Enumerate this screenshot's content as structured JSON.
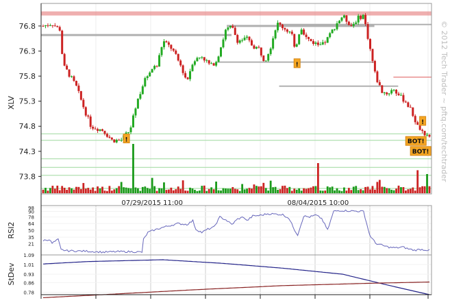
{
  "watermark": "© 2012 Tech Trader ~ pftq.com/techtrader",
  "chart_data": [
    {
      "type": "candlestick",
      "ylabel": "XLV",
      "ylim": [
        73.45,
        77.25
      ],
      "yticks": [
        73.8,
        74.3,
        74.8,
        75.3,
        75.8,
        76.3,
        76.8
      ],
      "x_labels": [
        {
          "label": "07/29/2015 11:00",
          "index": 46
        },
        {
          "label": "08/04/2015 10:00",
          "index": 116
        }
      ],
      "n_bars": 164,
      "anchors": [
        [
          0,
          76.8
        ],
        [
          6,
          76.85
        ],
        [
          10,
          76.75
        ],
        [
          12,
          76.72
        ],
        [
          13,
          76.02
        ],
        [
          16,
          75.9
        ],
        [
          22,
          75.6
        ],
        [
          28,
          75.1
        ],
        [
          32,
          74.8
        ],
        [
          40,
          74.72
        ],
        [
          46,
          74.52
        ],
        [
          52,
          74.52
        ],
        [
          58,
          74.72
        ],
        [
          62,
          75.2
        ],
        [
          66,
          75.6
        ],
        [
          72,
          75.95
        ],
        [
          76,
          76.0
        ],
        [
          80,
          76.5
        ],
        [
          86,
          76.35
        ],
        [
          92,
          76.0
        ],
        [
          96,
          75.7
        ],
        [
          100,
          76.1
        ],
        [
          106,
          76.2
        ],
        [
          112,
          76.0
        ],
        [
          116,
          76.12
        ],
        [
          122,
          76.72
        ],
        [
          126,
          76.78
        ],
        [
          130,
          76.5
        ],
        [
          136,
          76.55
        ],
        [
          140,
          76.4
        ],
        [
          144,
          76.35
        ],
        [
          148,
          76.1
        ],
        [
          152,
          76.4
        ],
        [
          156,
          76.85
        ],
        [
          160,
          76.78
        ],
        [
          166,
          76.65
        ],
        [
          168,
          76.3
        ],
        [
          172,
          76.8
        ],
        [
          176,
          76.55
        ],
        [
          180,
          76.48
        ],
        [
          186,
          76.4
        ],
        [
          190,
          76.55
        ],
        [
          196,
          76.85
        ],
        [
          200,
          77.0
        ],
        [
          206,
          76.8
        ],
        [
          210,
          76.95
        ],
        [
          214,
          77.02
        ],
        [
          218,
          76.4
        ],
        [
          222,
          75.8
        ],
        [
          226,
          75.5
        ],
        [
          230,
          75.45
        ],
        [
          234,
          75.55
        ],
        [
          238,
          75.4
        ],
        [
          242,
          75.3
        ],
        [
          246,
          75.1
        ],
        [
          250,
          74.8
        ],
        [
          252,
          74.7
        ],
        [
          258,
          74.62
        ]
      ],
      "up_color": "#22aa22",
      "down_color": "#cc2222",
      "volume": {
        "sample_bars": [
          {
            "i": 38,
            "v": 0.9
          },
          {
            "i": 46,
            "v": 0.28
          },
          {
            "i": 116,
            "v": 0.55
          },
          {
            "i": 158,
            "v": 0.42
          },
          {
            "i": 162,
            "v": 0.35
          }
        ]
      },
      "resistance_lines": [
        {
          "from": 0,
          "to": 164,
          "price": 77.05,
          "color": "#e06060",
          "width": 6,
          "opacity": 0.5
        },
        {
          "from": 0,
          "to": 80,
          "price": 76.62,
          "color": "#b0b0b0",
          "width": 3
        },
        {
          "from": 78,
          "to": 140,
          "price": 76.8,
          "color": "#b0b0b0",
          "width": 3
        },
        {
          "from": 100,
          "to": 164,
          "price": 76.83,
          "color": "#b0b0b0",
          "width": 2
        },
        {
          "from": 74,
          "to": 140,
          "price": 76.08,
          "color": "#b0b0b0",
          "width": 2
        },
        {
          "from": 100,
          "to": 150,
          "price": 75.6,
          "color": "#b0b0b0",
          "width": 2
        },
        {
          "from": 148,
          "to": 164,
          "price": 75.78,
          "color": "#e06060",
          "width": 1
        }
      ],
      "support_lines": [
        {
          "price": 74.65,
          "color": "#9ed89e"
        },
        {
          "price": 74.52,
          "color": "#9ed89e"
        },
        {
          "price": 74.15,
          "color": "#9ed89e"
        },
        {
          "price": 73.98,
          "color": "#9ed89e"
        },
        {
          "price": 73.82,
          "color": "#9ed89e"
        },
        {
          "price": 73.56,
          "color": "#9ed89e"
        }
      ],
      "signals": [
        {
          "type": "warning",
          "label": "!",
          "index": 35,
          "price": 74.55
        },
        {
          "type": "warning",
          "label": "!",
          "index": 107,
          "price": 76.05
        },
        {
          "type": "warning",
          "label": "!",
          "index": 160,
          "price": 74.9
        },
        {
          "type": "buy",
          "label": "BOT!",
          "index": 157,
          "price": 74.5
        },
        {
          "type": "buy",
          "label": "BOT!",
          "index": 159,
          "price": 74.3
        }
      ]
    },
    {
      "type": "line",
      "ylabel": "RSI2",
      "ylim": [
        0,
        98
      ],
      "yticks": [
        98,
        90,
        78,
        64,
        50,
        35,
        21
      ],
      "color": "#6666bb",
      "anchors": [
        [
          0,
          28
        ],
        [
          4,
          30
        ],
        [
          6,
          22
        ],
        [
          10,
          30
        ],
        [
          12,
          8
        ],
        [
          16,
          6
        ],
        [
          30,
          5
        ],
        [
          40,
          3
        ],
        [
          50,
          4
        ],
        [
          60,
          4
        ],
        [
          66,
          3
        ],
        [
          67,
          30
        ],
        [
          70,
          45
        ],
        [
          74,
          50
        ],
        [
          80,
          56
        ],
        [
          90,
          64
        ],
        [
          96,
          62
        ],
        [
          100,
          70
        ],
        [
          102,
          52
        ],
        [
          106,
          45
        ],
        [
          110,
          52
        ],
        [
          114,
          56
        ],
        [
          118,
          78
        ],
        [
          122,
          72
        ],
        [
          126,
          62
        ],
        [
          130,
          74
        ],
        [
          134,
          78
        ],
        [
          136,
          70
        ],
        [
          140,
          80
        ],
        [
          146,
          82
        ],
        [
          150,
          85
        ],
        [
          156,
          84
        ],
        [
          160,
          83
        ],
        [
          164,
          76
        ],
        [
          168,
          50
        ],
        [
          170,
          40
        ],
        [
          174,
          80
        ],
        [
          178,
          78
        ],
        [
          182,
          82
        ],
        [
          186,
          75
        ],
        [
          190,
          50
        ],
        [
          194,
          90
        ],
        [
          198,
          92
        ],
        [
          206,
          91
        ],
        [
          214,
          90
        ],
        [
          218,
          40
        ],
        [
          222,
          22
        ],
        [
          228,
          16
        ],
        [
          232,
          13
        ],
        [
          236,
          12
        ],
        [
          240,
          14
        ],
        [
          244,
          10
        ],
        [
          248,
          7
        ],
        [
          252,
          9
        ],
        [
          258,
          7
        ]
      ],
      "n_points": 259
    },
    {
      "type": "line",
      "ylabel": "StDev",
      "ylim": [
        0.76,
        1.09
      ],
      "yticks": [
        1.09,
        1.01,
        0.93,
        0.86,
        0.78
      ],
      "series": [
        {
          "color": "#222288",
          "anchors": [
            [
              0,
              1.015
            ],
            [
              30,
              1.035
            ],
            [
              80,
              1.05
            ],
            [
              120,
              1.02
            ],
            [
              160,
              0.98
            ],
            [
              200,
              0.93
            ],
            [
              230,
              0.84
            ],
            [
              258,
              0.76
            ]
          ]
        },
        {
          "color": "#882222",
          "anchors": [
            [
              0,
              0.735
            ],
            [
              40,
              0.76
            ],
            [
              100,
              0.8
            ],
            [
              160,
              0.835
            ],
            [
              220,
              0.855
            ],
            [
              258,
              0.865
            ]
          ]
        }
      ],
      "n_points": 259
    }
  ]
}
